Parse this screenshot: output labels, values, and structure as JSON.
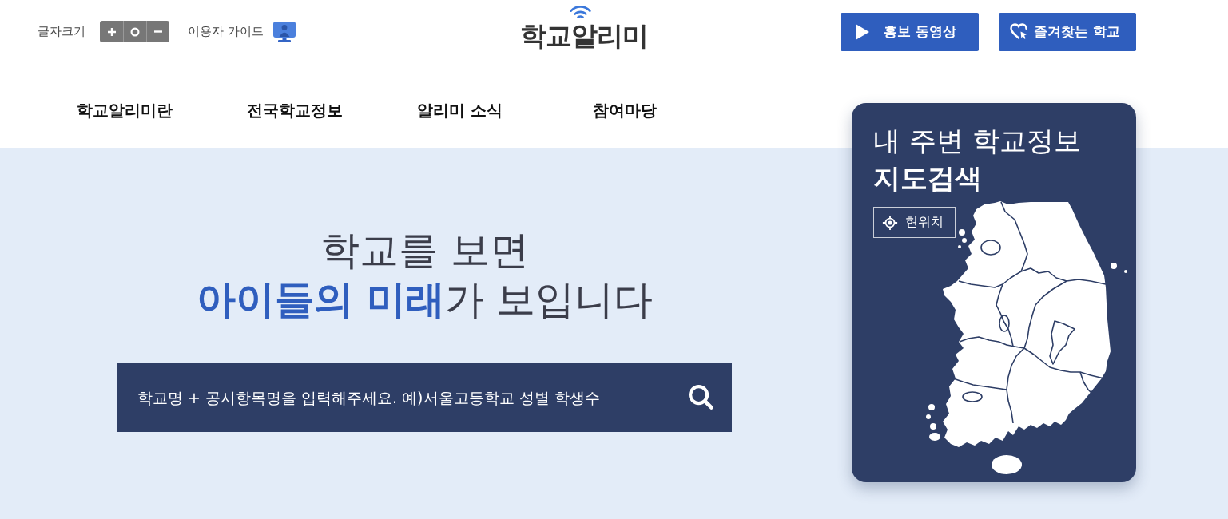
{
  "header": {
    "font_size": {
      "label": "글자크기",
      "buttons": [
        {
          "kind": "increase"
        },
        {
          "kind": "reset"
        },
        {
          "kind": "decrease"
        }
      ]
    },
    "user_guide": {
      "label": "이용자 가이드"
    },
    "logo": {
      "text": "학교알리미"
    },
    "buttons": [
      {
        "kind": "video",
        "label": "홍보 동영상"
      },
      {
        "kind": "favorites",
        "label": "즐겨찾는 학교"
      }
    ]
  },
  "nav": [
    {
      "label": "학교알리미란"
    },
    {
      "label": "전국학교정보"
    },
    {
      "label": "알리미 소식"
    },
    {
      "label": "참여마당"
    }
  ],
  "hero": {
    "headline": [
      "학교를 보면",
      "**아이들의 미래**가 보입니다"
    ],
    "search": {
      "placeholder": "학교명 + 공시항목명을 입력해주세요. 예)서울고등학교 성별 학생수"
    }
  },
  "map_card": {
    "title": "내 주변 학교정보",
    "subtitle": "지도검색",
    "location_button": {
      "label": "현위치"
    }
  }
}
